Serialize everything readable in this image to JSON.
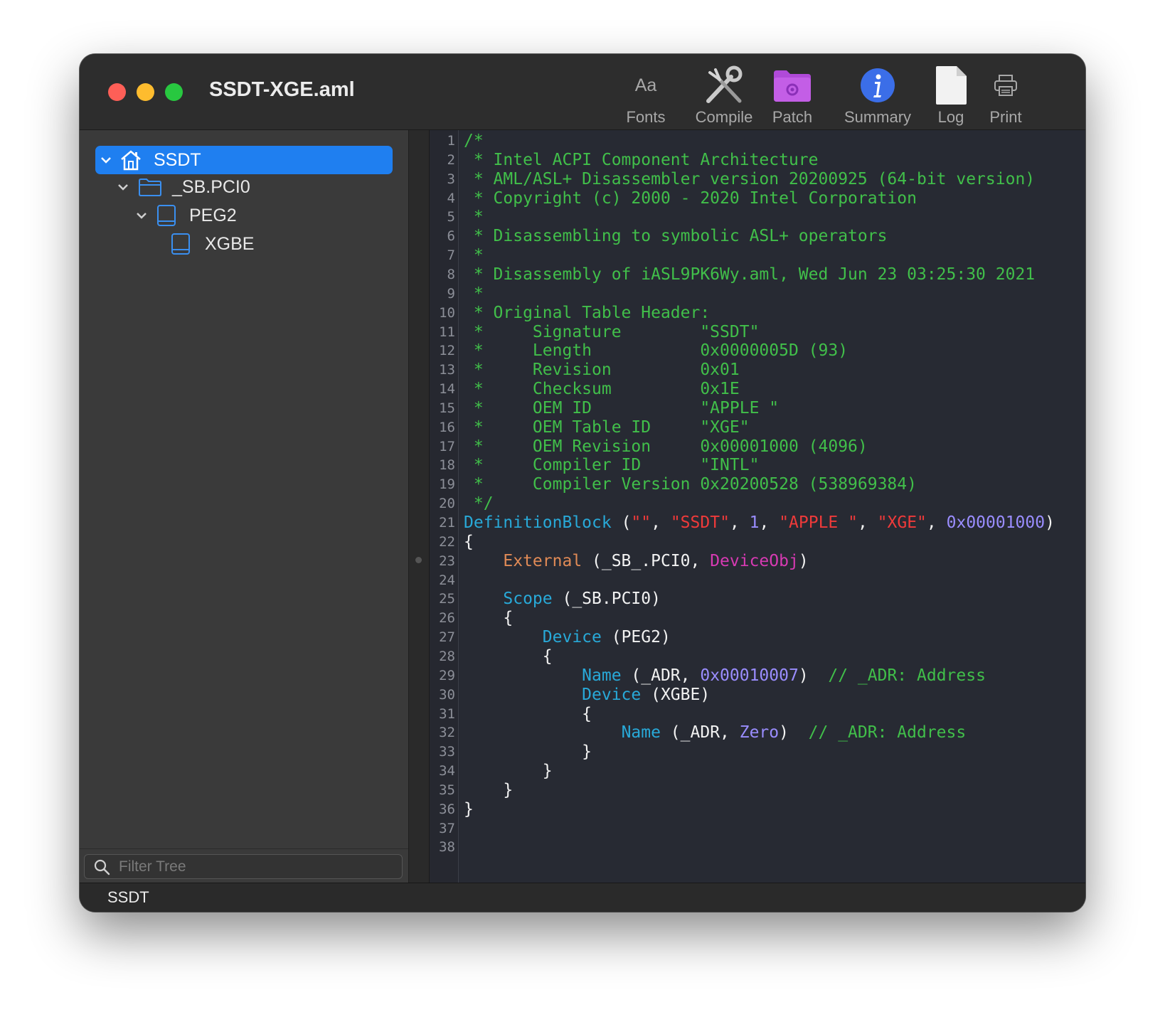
{
  "window": {
    "title": "SSDT-XGE.aml"
  },
  "toolbar": {
    "fonts_label": "Fonts",
    "fonts_icon_text": "Aa",
    "compile_label": "Compile",
    "patch_label": "Patch",
    "summary_label": "Summary",
    "log_label": "Log",
    "print_label": "Print"
  },
  "tree": {
    "items": [
      {
        "label": "SSDT",
        "icon": "house-icon"
      },
      {
        "label": "_SB.PCI0",
        "icon": "folder-icon"
      },
      {
        "label": "PEG2",
        "icon": "device-icon"
      },
      {
        "label": "XGBE",
        "icon": "device-icon"
      }
    ]
  },
  "filter": {
    "placeholder": "Filter Tree"
  },
  "status": {
    "text": "SSDT"
  },
  "colors": {
    "selection": "#1f7ff0",
    "comment": "#41bf4a",
    "keyword": "#28a9d8",
    "string": "#ef3a3a",
    "number": "#9a8dff",
    "external": "#e08a56",
    "object_type": "#d73ab3"
  },
  "code": [
    [
      [
        "com",
        "/*"
      ]
    ],
    [
      [
        "com",
        " * Intel ACPI Component Architecture"
      ]
    ],
    [
      [
        "com",
        " * AML/ASL+ Disassembler version 20200925 (64-bit version)"
      ]
    ],
    [
      [
        "com",
        " * Copyright (c) 2000 - 2020 Intel Corporation"
      ]
    ],
    [
      [
        "com",
        " *"
      ]
    ],
    [
      [
        "com",
        " * Disassembling to symbolic ASL+ operators"
      ]
    ],
    [
      [
        "com",
        " *"
      ]
    ],
    [
      [
        "com",
        " * Disassembly of iASL9PK6Wy.aml, Wed Jun 23 03:25:30 2021"
      ]
    ],
    [
      [
        "com",
        " *"
      ]
    ],
    [
      [
        "com",
        " * Original Table Header:"
      ]
    ],
    [
      [
        "com",
        " *     Signature        \"SSDT\""
      ]
    ],
    [
      [
        "com",
        " *     Length           0x0000005D (93)"
      ]
    ],
    [
      [
        "com",
        " *     Revision         0x01"
      ]
    ],
    [
      [
        "com",
        " *     Checksum         0x1E"
      ]
    ],
    [
      [
        "com",
        " *     OEM ID           \"APPLE \""
      ]
    ],
    [
      [
        "com",
        " *     OEM Table ID     \"XGE\""
      ]
    ],
    [
      [
        "com",
        " *     OEM Revision     0x00001000 (4096)"
      ]
    ],
    [
      [
        "com",
        " *     Compiler ID      \"INTL\""
      ]
    ],
    [
      [
        "com",
        " *     Compiler Version 0x20200528 (538969384)"
      ]
    ],
    [
      [
        "com",
        " */"
      ]
    ],
    [
      [
        "kw",
        "DefinitionBlock"
      ],
      [
        "txt",
        " ("
      ],
      [
        "str",
        "\"\""
      ],
      [
        "txt",
        ", "
      ],
      [
        "str",
        "\"SSDT\""
      ],
      [
        "txt",
        ", "
      ],
      [
        "num",
        "1"
      ],
      [
        "txt",
        ", "
      ],
      [
        "str",
        "\"APPLE \""
      ],
      [
        "txt",
        ", "
      ],
      [
        "str",
        "\"XGE\""
      ],
      [
        "txt",
        ", "
      ],
      [
        "num",
        "0x00001000"
      ],
      [
        "txt",
        ")"
      ]
    ],
    [
      [
        "txt",
        "{"
      ]
    ],
    [
      [
        "txt",
        "    "
      ],
      [
        "ext",
        "External"
      ],
      [
        "txt",
        " (_SB_.PCI0, "
      ],
      [
        "obj",
        "DeviceObj"
      ],
      [
        "txt",
        ")"
      ]
    ],
    [
      [
        "txt",
        ""
      ]
    ],
    [
      [
        "txt",
        "    "
      ],
      [
        "kw",
        "Scope"
      ],
      [
        "txt",
        " (_SB.PCI0)"
      ]
    ],
    [
      [
        "txt",
        "    {"
      ]
    ],
    [
      [
        "txt",
        "        "
      ],
      [
        "kw",
        "Device"
      ],
      [
        "txt",
        " (PEG2)"
      ]
    ],
    [
      [
        "txt",
        "        {"
      ]
    ],
    [
      [
        "txt",
        "            "
      ],
      [
        "kw",
        "Name"
      ],
      [
        "txt",
        " (_ADR, "
      ],
      [
        "num",
        "0x00010007"
      ],
      [
        "txt",
        ")  "
      ],
      [
        "com",
        "// _ADR: Address"
      ]
    ],
    [
      [
        "txt",
        "            "
      ],
      [
        "kw",
        "Device"
      ],
      [
        "txt",
        " (XGBE)"
      ]
    ],
    [
      [
        "txt",
        "            {"
      ]
    ],
    [
      [
        "txt",
        "                "
      ],
      [
        "kw",
        "Name"
      ],
      [
        "txt",
        " (_ADR, "
      ],
      [
        "num",
        "Zero"
      ],
      [
        "txt",
        ")  "
      ],
      [
        "com",
        "// _ADR: Address"
      ]
    ],
    [
      [
        "txt",
        "            }"
      ]
    ],
    [
      [
        "txt",
        "        }"
      ]
    ],
    [
      [
        "txt",
        "    }"
      ]
    ],
    [
      [
        "txt",
        "}"
      ]
    ],
    [
      [
        "txt",
        ""
      ]
    ],
    [
      [
        "txt",
        ""
      ]
    ]
  ]
}
